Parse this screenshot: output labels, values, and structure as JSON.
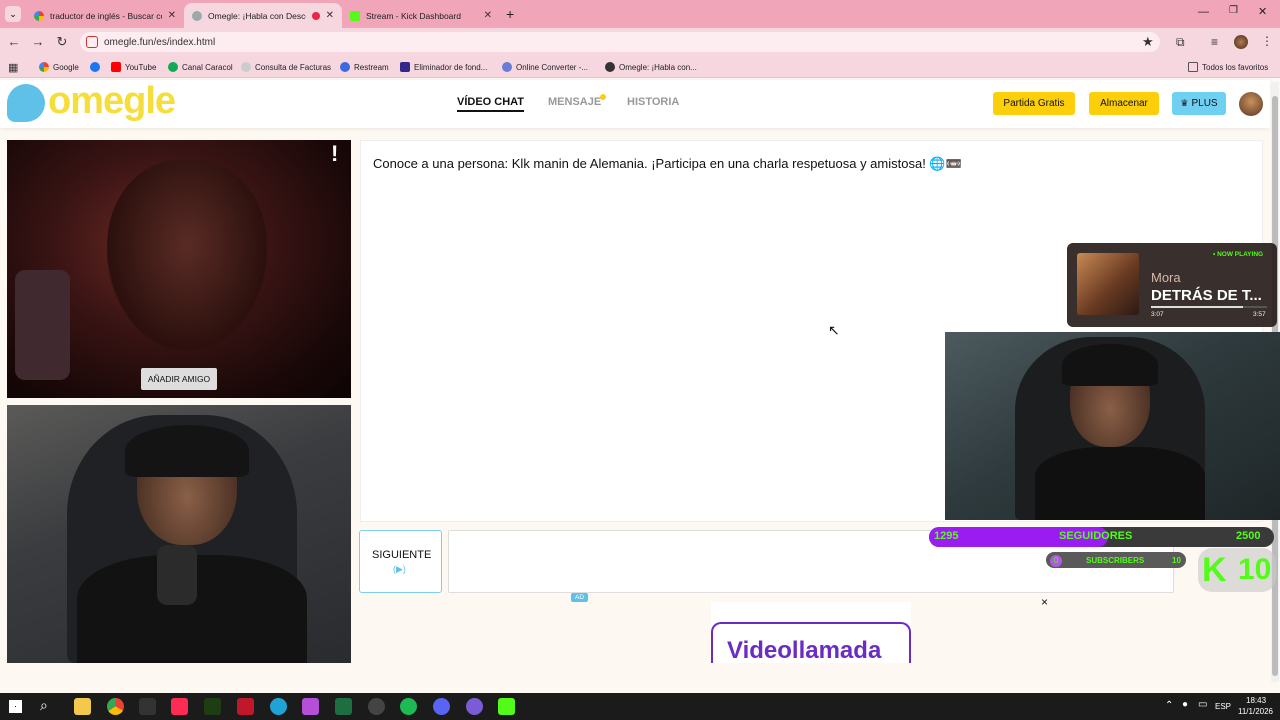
{
  "browser": {
    "tabs": [
      {
        "title": "traductor de inglés - Buscar con",
        "active": false
      },
      {
        "title": "Omegle: ¡Habla con Descon",
        "active": true
      },
      {
        "title": "Stream - Kick Dashboard",
        "active": false
      }
    ],
    "url": "omegle.fun/es/index.html",
    "bookmarks": [
      "Google",
      "YouTube",
      "Canal Caracol",
      "Consulta de Facturas",
      "Restream",
      "Eliminador de fond...",
      "Online Converter -...",
      "Omegle: ¡Habla con..."
    ],
    "all_favorites": "Todos los favoritos"
  },
  "site": {
    "logo": "omegle",
    "nav": [
      {
        "label": "VÍDEO CHAT",
        "active": true
      },
      {
        "label": "MENSAJE",
        "active": false
      },
      {
        "label": "HISTORIA",
        "active": false
      }
    ],
    "buttons": {
      "free_game": "Partida Gratis",
      "store": "Almacenar",
      "plus": "PLUS"
    }
  },
  "video": {
    "report_mark": "!",
    "add_friend": "AÑADIR AMIGO"
  },
  "chat": {
    "message": "Conoce a una persona: Klk manin de Alemania. ¡Participa en una charla respetuosa y amistosa! 🌐📼",
    "next_button": "SIGUIENTE",
    "next_hint": "(▶)",
    "input_value": ""
  },
  "ad": {
    "badge": "AD",
    "close": "×",
    "headline": "Videollamada"
  },
  "overlays": {
    "now_playing": {
      "badge": "• NOW PLAYING",
      "artist": "Mora",
      "title": "DETRÁS DE T...",
      "elapsed": "3:07",
      "duration": "3:57",
      "progress": 0.79
    },
    "followers": {
      "current": "1295",
      "label": "SEGUIDORES",
      "goal": "2500",
      "progress": 0.52
    },
    "subs": {
      "current": "0",
      "label": "SUBSCRIBERS",
      "goal": "10",
      "progress": 0.0
    },
    "kick_count": "10"
  },
  "taskbar": {
    "language": "ESP",
    "time": "18:43",
    "date": "11/1/2026"
  },
  "colors": {
    "brand_yellow": "#fccf0a",
    "brand_blue": "#6fd0f2",
    "tab_bar": "#f0a5b8",
    "kick_green": "#53fc18",
    "follower_purple": "#9b1cf0"
  }
}
